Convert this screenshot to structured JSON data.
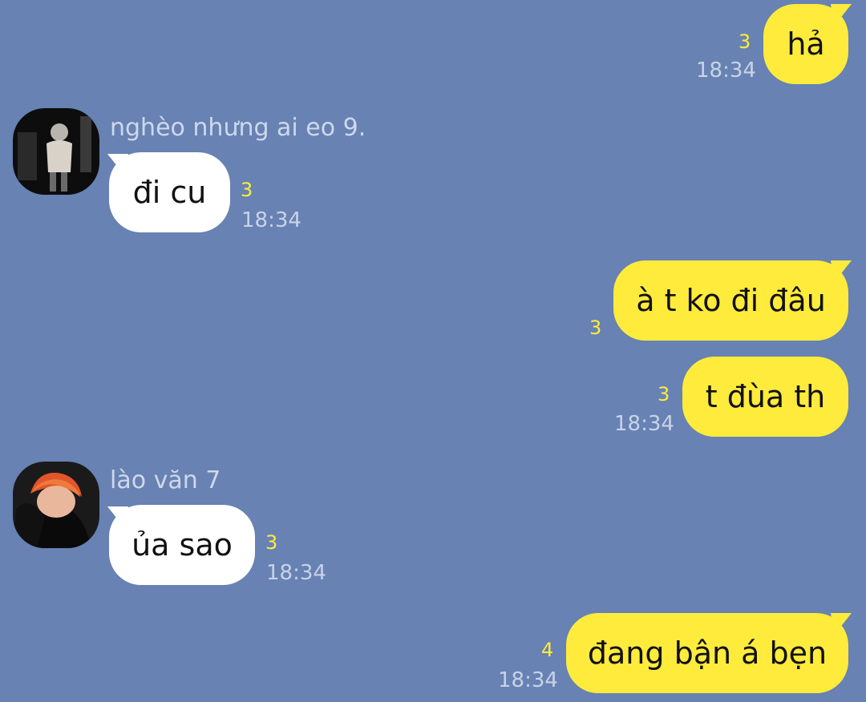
{
  "colors": {
    "background": "#6782b3",
    "outgoing_bubble": "#ffeb3b",
    "incoming_bubble": "#ffffff",
    "unread_count": "#ffeb3b",
    "timestamp": "#c9d3e6"
  },
  "messages": [
    {
      "direction": "outgoing",
      "text": "hả",
      "unread": "3",
      "time": "18:34"
    },
    {
      "direction": "incoming",
      "sender": "nghèo nhưng ai eo 9.",
      "avatar": "avatar-photo-dark",
      "text": "đi cu",
      "unread": "3",
      "time": "18:34"
    },
    {
      "direction": "outgoing",
      "text": "à t ko đi đâu",
      "unread": "3",
      "time": ""
    },
    {
      "direction": "outgoing",
      "text": "t đùa th",
      "unread": "3",
      "time": "18:34"
    },
    {
      "direction": "incoming",
      "sender": "lào văn 7",
      "avatar": "avatar-photo-orange-hair",
      "text": "ủa sao",
      "unread": "3",
      "time": "18:34"
    },
    {
      "direction": "outgoing",
      "text": "đang bận á bẹn",
      "unread": "4",
      "time": "18:34"
    }
  ]
}
